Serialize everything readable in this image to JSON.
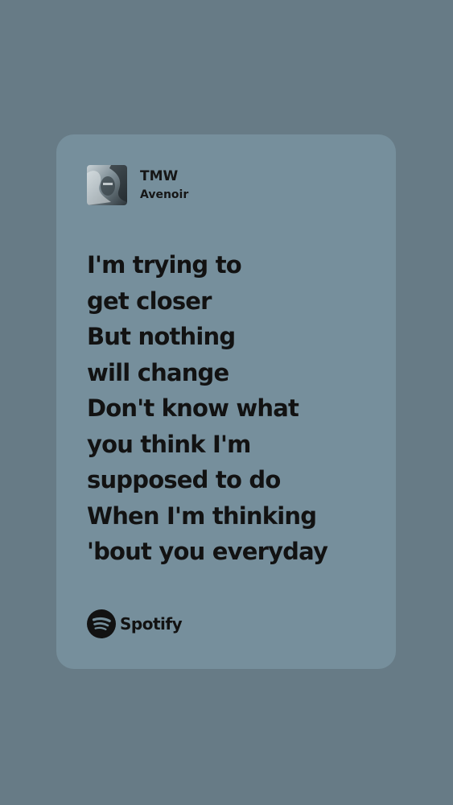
{
  "track": {
    "title": "TMW",
    "artist": "Avenoir"
  },
  "lyrics": [
    "I'm trying to",
    "get closer",
    "But nothing",
    "will change",
    "Don't know what",
    "you think I'm",
    "supposed to do",
    "When I'm thinking",
    "'bout you everyday"
  ],
  "brand": {
    "name": "Spotify",
    "icon": "spotify-logo-icon"
  },
  "colors": {
    "background": "#677b86",
    "card": "#768f9c",
    "text": "#121212"
  }
}
